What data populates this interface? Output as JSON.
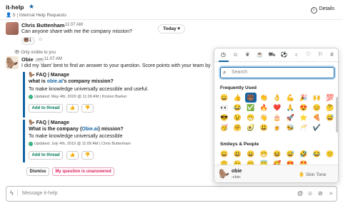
{
  "channel": {
    "name": "it-help",
    "star_icon": "star-icon",
    "member_count": "5",
    "topic": "Internal Help Requests",
    "details_label": "Details"
  },
  "messages": [
    {
      "author": "Chris Buttenham",
      "time": "11:07 AM",
      "text": "Can anyone share with me the company mission?",
      "reaction": {
        "emoji": "🐻",
        "count": "1"
      }
    },
    {
      "visibility_note": "Only visible to you",
      "author": "Obie",
      "badge": "APP",
      "time": "11:07 AM",
      "text": "I did my 'dam' best to find an answer to your question. Score points with your team by"
    }
  ],
  "day_divider": "Today",
  "cards": [
    {
      "title": "FAQ | Manage",
      "question_pre": "what is ",
      "question_link": "obie.ai",
      "question_post": "'s company mission?",
      "answer": "To make knowledge universally accessible and useful.",
      "updated": "Updated: May 4th, 2020 @ 11:09 AM | Kristen Barker",
      "add_label": "Add to thread",
      "up": "👍",
      "down": "👎"
    },
    {
      "title": "FAQ | Manage",
      "question_pre": "What is the company (",
      "question_link": "Obie.ai",
      "question_post": ") mission?",
      "answer": "To make knowledge universally accessible",
      "updated": "Updated: July 4th, 2019 @ 11:09 AM | Chris Buttenham",
      "add_label": "Add to thread",
      "up": "👍",
      "down": "👎"
    }
  ],
  "actions": {
    "dismiss": "Dismiss",
    "unanswered": "My question is unanswered"
  },
  "composer": {
    "placeholder": "Message it-help",
    "icons": [
      "at-icon",
      "emoji-icon",
      "attach-icon",
      "send-icon"
    ]
  },
  "picker": {
    "search_placeholder": "Search",
    "frequently_used_label": "Frequently Used",
    "smileys_label": "Smileys & People",
    "frequent": [
      "😀",
      "👍",
      "🐻",
      "👏",
      "👌",
      "💪",
      "🎉",
      "🙌",
      "💯",
      "👀",
      "😂",
      "✅",
      "🔥",
      "❤️",
      "🙏",
      "😍",
      "😊",
      "🤔",
      "😎",
      "😉",
      "😁",
      "👋",
      "🎂",
      "🚀",
      "⭐",
      "🍕",
      "😅",
      "🥳",
      "🤗",
      "🥑",
      "😃",
      "🍺",
      "🐝",
      "🥂",
      "✔️"
    ],
    "smileys": [
      "😀",
      "😃",
      "😄",
      "😁",
      "😆",
      "😅",
      "🤣",
      "😂",
      "🙂",
      "🙃",
      "😉",
      "😊",
      "😇",
      "🥰",
      "😍",
      "🤩"
    ],
    "footer_name": "obie",
    "footer_code": ":obie:",
    "skin_tone_label": "Skin Tone",
    "skin_tone_emoji": "✋"
  }
}
